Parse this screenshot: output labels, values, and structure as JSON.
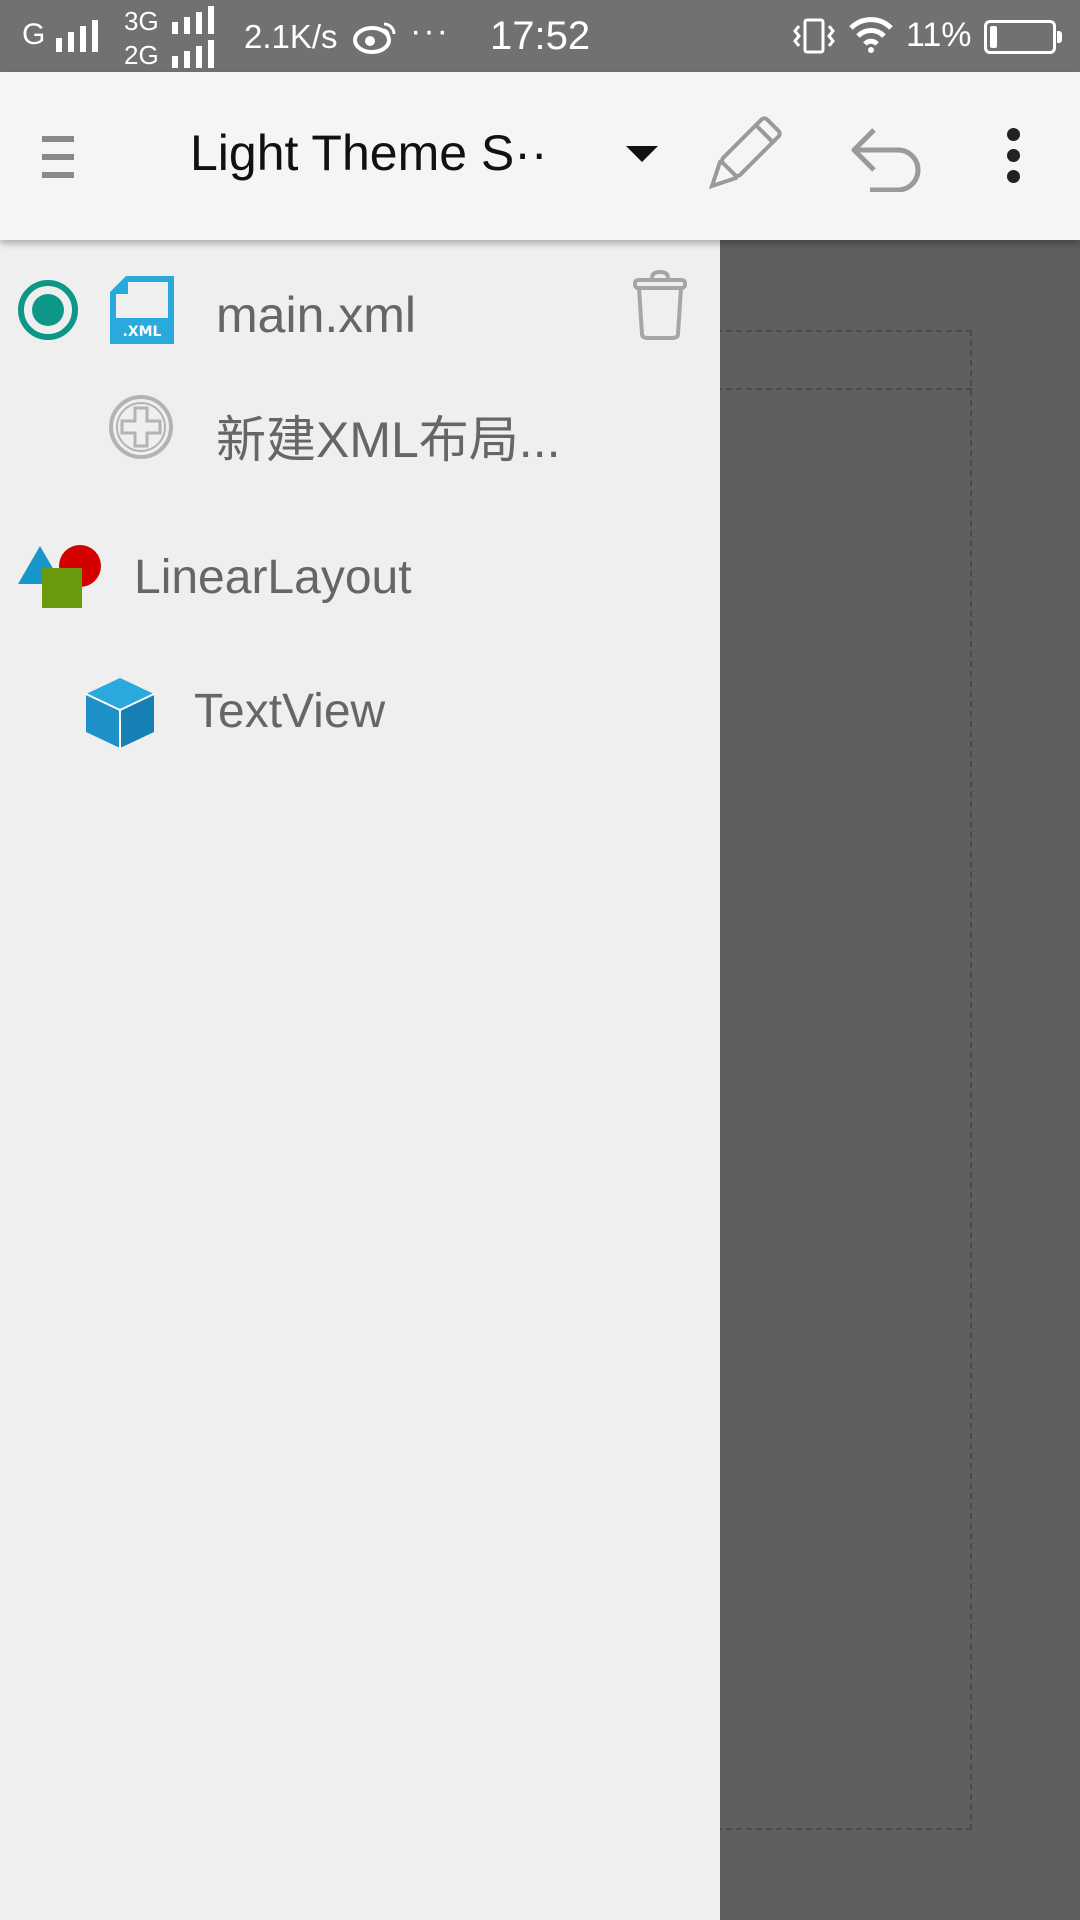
{
  "status_bar": {
    "carrier_1": "G",
    "network_top": "3G",
    "network_bottom": "2G",
    "speed": "2.1K/s",
    "more": "···",
    "time": "17:52",
    "battery_percent": "11%",
    "battery_level": 0.11,
    "icons": [
      "signal-icon",
      "weibo-icon",
      "vibrate-icon",
      "wifi-icon",
      "battery-icon"
    ]
  },
  "toolbar": {
    "title": "Light Theme S··",
    "icons": [
      "menu-icon",
      "dropdown-icon",
      "pencil-icon",
      "undo-icon",
      "more-vert-icon"
    ]
  },
  "drawer": {
    "files": [
      {
        "name": "main.xml",
        "selected": true,
        "icon": "xml-file-icon"
      }
    ],
    "new_layout_label": "新建XML布局...",
    "tree": [
      {
        "label": "LinearLayout",
        "icon": "layout-shapes-icon",
        "depth": 0
      },
      {
        "label": "TextView",
        "icon": "cube-icon",
        "depth": 1
      }
    ]
  },
  "colors": {
    "accent": "#0e9686",
    "xml_icon": "#29a9dc",
    "drawer_bg": "#efefef",
    "canvas_bg": "#5f5f5f",
    "status_bar_bg": "#717171"
  }
}
